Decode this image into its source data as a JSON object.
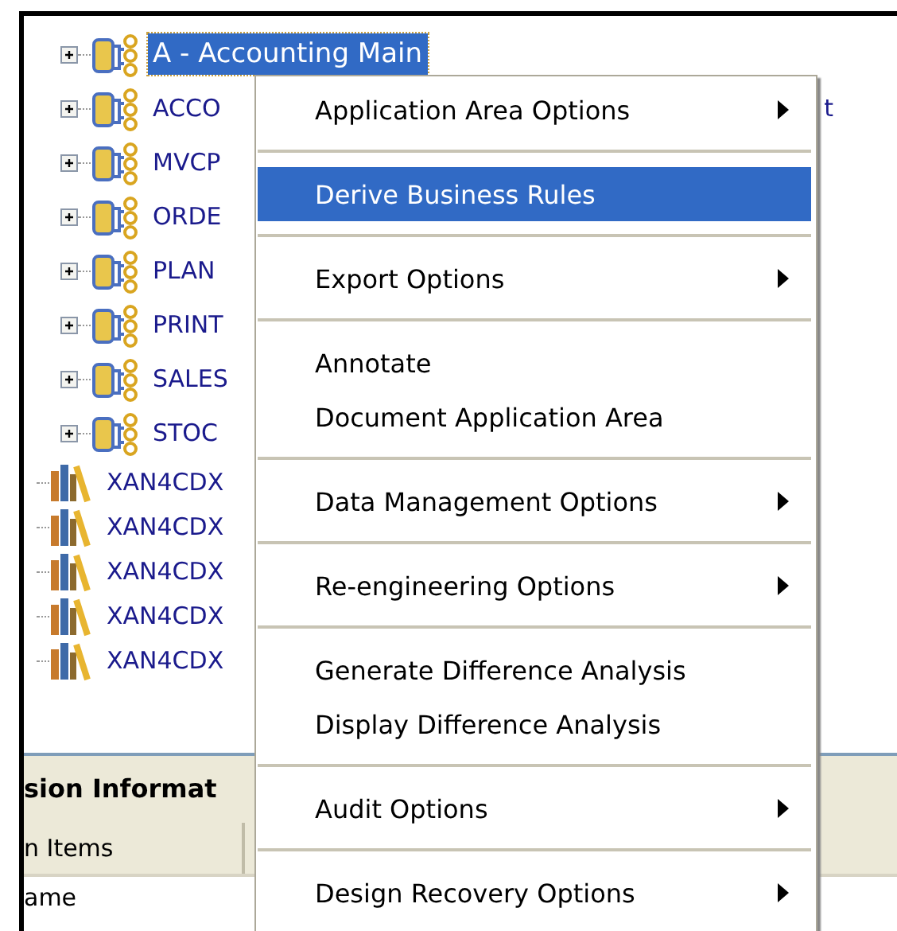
{
  "tree": {
    "items": [
      {
        "label": "A - Accounting Main",
        "kind": "app_area",
        "selected": true
      },
      {
        "label": "ACCO",
        "kind": "app_area",
        "selected": false,
        "trailing_text": "t"
      },
      {
        "label": "MVCP",
        "kind": "app_area",
        "selected": false
      },
      {
        "label": "ORDE",
        "kind": "app_area",
        "selected": false
      },
      {
        "label": "PLAN",
        "kind": "app_area",
        "selected": false
      },
      {
        "label": "PRINT",
        "kind": "app_area",
        "selected": false
      },
      {
        "label": "SALES",
        "kind": "app_area",
        "selected": false
      },
      {
        "label": "STOC",
        "kind": "app_area",
        "selected": false
      },
      {
        "label": "XAN4CDX",
        "kind": "library",
        "selected": false
      },
      {
        "label": "XAN4CDX",
        "kind": "library",
        "selected": false
      },
      {
        "label": "XAN4CDX",
        "kind": "library",
        "selected": false
      },
      {
        "label": "XAN4CDX",
        "kind": "library",
        "selected": false
      },
      {
        "label": "XAN4CDX",
        "kind": "library",
        "selected": false
      }
    ]
  },
  "panel": {
    "title": "sion Informat",
    "column": "n Items",
    "cell": "ame"
  },
  "context_menu": {
    "groups": [
      [
        {
          "label": "Application Area Options",
          "submenu": true,
          "selected": false
        }
      ],
      [
        {
          "label": "Derive Business Rules",
          "submenu": false,
          "selected": true
        }
      ],
      [
        {
          "label": "Export Options",
          "submenu": true,
          "selected": false
        }
      ],
      [
        {
          "label": "Annotate",
          "submenu": false,
          "selected": false
        },
        {
          "label": "Document Application Area",
          "submenu": false,
          "selected": false
        }
      ],
      [
        {
          "label": "Data Management Options",
          "submenu": true,
          "selected": false
        }
      ],
      [
        {
          "label": "Re-engineering Options",
          "submenu": true,
          "selected": false
        }
      ],
      [
        {
          "label": "Generate Difference Analysis",
          "submenu": false,
          "selected": false
        },
        {
          "label": "Display Difference Analysis",
          "submenu": false,
          "selected": false
        }
      ],
      [
        {
          "label": "Audit Options",
          "submenu": true,
          "selected": false
        }
      ],
      [
        {
          "label": "Design Recovery Options",
          "submenu": true,
          "selected": false
        }
      ]
    ]
  }
}
